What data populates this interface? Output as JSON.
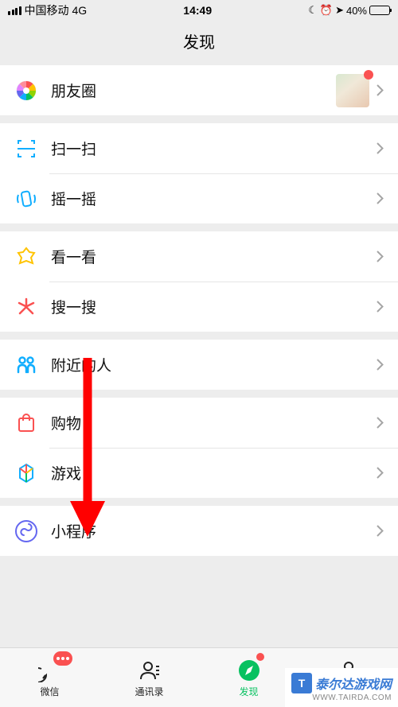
{
  "status": {
    "carrier": "中国移动",
    "network": "4G",
    "time": "14:49",
    "battery_pct": "40%"
  },
  "header": {
    "title": "发现"
  },
  "sections": [
    {
      "items": [
        {
          "key": "moments",
          "label": "朋友圈",
          "has_avatar": true,
          "red_dot": true
        }
      ]
    },
    {
      "items": [
        {
          "key": "scan",
          "label": "扫一扫"
        },
        {
          "key": "shake",
          "label": "摇一摇"
        }
      ]
    },
    {
      "items": [
        {
          "key": "look",
          "label": "看一看"
        },
        {
          "key": "search",
          "label": "搜一搜"
        }
      ]
    },
    {
      "items": [
        {
          "key": "nearby",
          "label": "附近的人"
        }
      ]
    },
    {
      "items": [
        {
          "key": "shopping",
          "label": "购物"
        },
        {
          "key": "games",
          "label": "游戏"
        }
      ]
    },
    {
      "items": [
        {
          "key": "miniprogram",
          "label": "小程序"
        }
      ]
    }
  ],
  "tabs": {
    "chat": "微信",
    "contacts": "通讯录",
    "discover": "发现",
    "me": "我"
  },
  "watermark": {
    "name": "泰尔达游戏网",
    "url": "WWW.TAIRDA.COM"
  }
}
